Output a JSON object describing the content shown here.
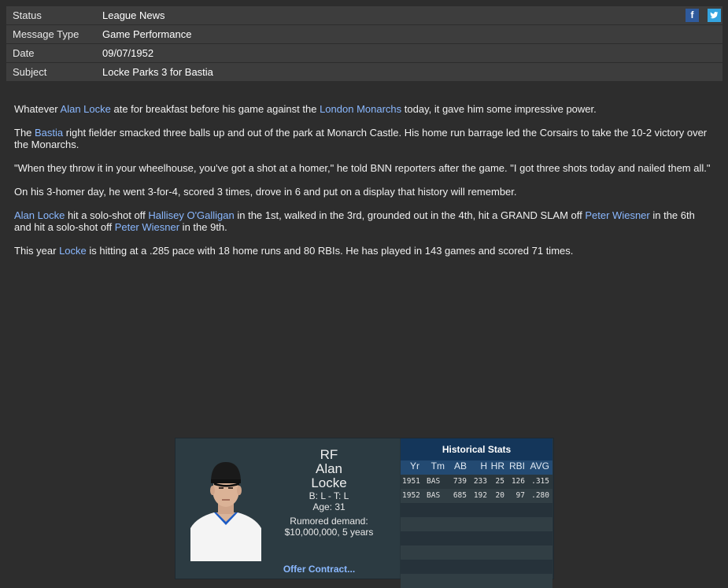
{
  "header": {
    "rows": [
      {
        "key": "Status",
        "value": "League News"
      },
      {
        "key": "Message Type",
        "value": "Game Performance"
      },
      {
        "key": "Date",
        "value": "09/07/1952"
      },
      {
        "key": "Subject",
        "value": "Locke Parks 3 for Bastia"
      }
    ],
    "social": {
      "facebook": "f",
      "twitter": "t"
    }
  },
  "article": {
    "p1": {
      "a": "Whatever ",
      "player": "Alan Locke",
      "b": " ate for breakfast before his game against the ",
      "team": "London Monarchs",
      "c": " today, it gave him some impressive power."
    },
    "p2": {
      "a": "The ",
      "team": "Bastia",
      "b": " right fielder smacked three balls up and out of the park at Monarch Castle. His home run barrage led the Corsairs to take the 10-2 victory over the Monarchs."
    },
    "p3": "\"When they throw it in your wheelhouse, you've got a shot at a homer,\" he told BNN reporters after the game. \"I got three shots today and nailed them all.\"",
    "p4": "On his 3-homer day, he went 3-for-4, scored 3 times, drove in 6 and put on a display that history will remember.",
    "p5": {
      "player": "Alan Locke",
      "a": " hit a solo-shot off ",
      "p2": "Hallisey O'Galligan",
      "b": " in the 1st, walked in the 3rd, grounded out in the 4th, hit a GRAND SLAM off ",
      "p3": "Peter Wiesner",
      "c": " in the 6th and hit a solo-shot off ",
      "p4": "Peter Wiesner",
      "d": " in the 9th."
    },
    "p6": {
      "a": "This year ",
      "player": "Locke",
      "b": " is hitting at a .285 pace with 18 home runs and 80 RBIs. He has played in 143 games and scored 71 times."
    }
  },
  "card": {
    "position": "RF",
    "first_name": "Alan",
    "last_name": "Locke",
    "bats_throws": "B: L - T: L",
    "age": "Age: 31",
    "demand_label": "Rumored demand:",
    "demand_value": "$10,000,000, 5 years",
    "offer": "Offer Contract...",
    "stats_title": "Historical Stats",
    "stats_cols": [
      "Yr",
      "Tm",
      "AB",
      "H",
      "HR",
      "RBI",
      "AVG"
    ],
    "stats_rows": [
      [
        "1951",
        "BAS",
        "739",
        "233",
        "25",
        "126",
        ".315"
      ],
      [
        "1952",
        "BAS",
        "685",
        "192",
        "20",
        "97",
        ".280"
      ]
    ]
  },
  "colors": {
    "link": "#8ab8ff",
    "stats_title_bg": "#14365a",
    "stats_head_bg": "#234a72"
  }
}
